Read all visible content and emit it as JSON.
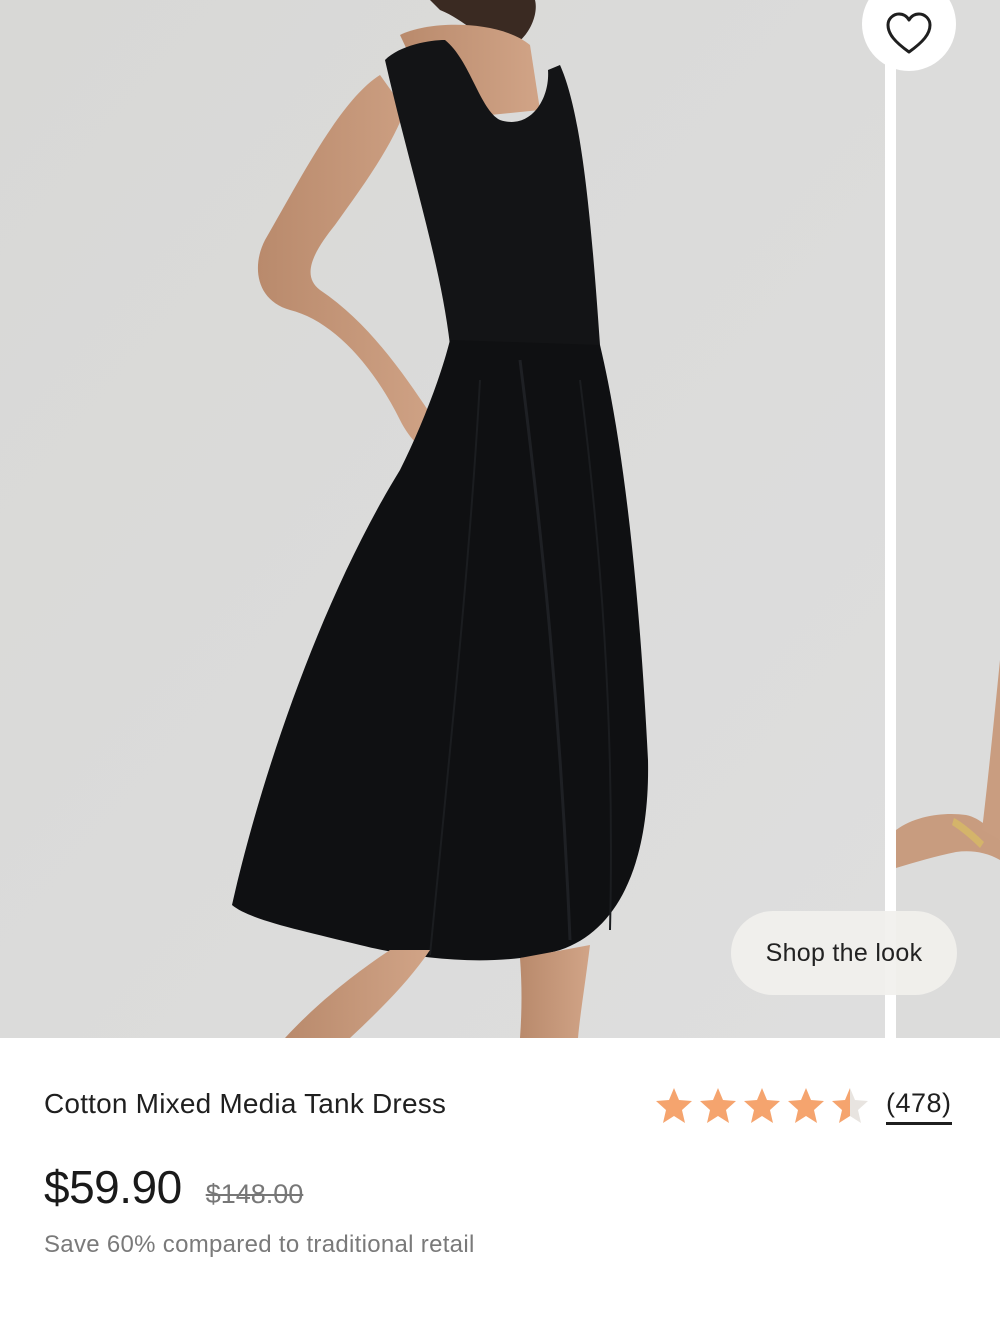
{
  "gallery": {
    "favorite_icon": "heart-outline-icon",
    "shop_the_look_label": "Shop the look",
    "background_color": "#d9d9d7",
    "garment_color": "#131416"
  },
  "product": {
    "title": "Cotton Mixed Media Tank Dress",
    "rating": {
      "value": 4.5,
      "max": 5,
      "review_count_label": "(478)",
      "star_color": "#f5a46e",
      "empty_star_color": "#e8e4e0"
    },
    "price": {
      "current": "$59.90",
      "original": "$148.00"
    },
    "savings_text": "Save 60% compared to traditional retail"
  }
}
